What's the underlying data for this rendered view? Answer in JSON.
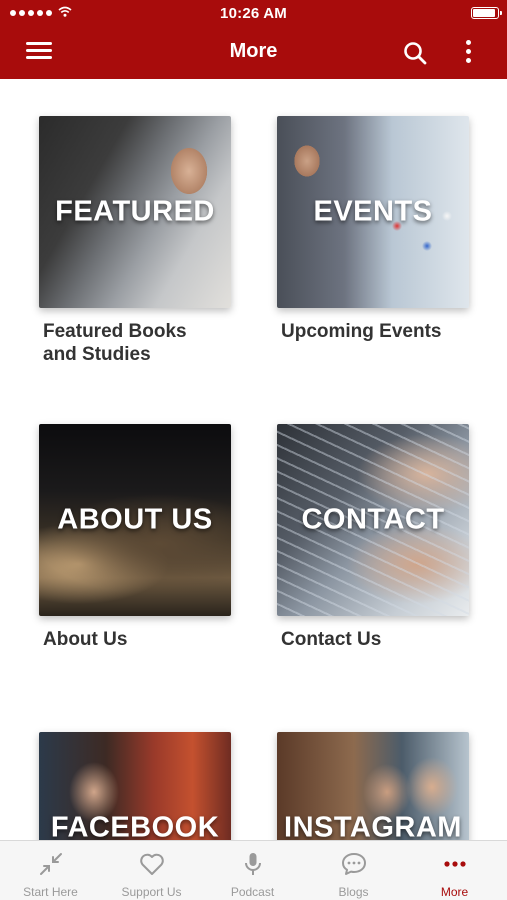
{
  "colors": {
    "brand": "#a80c0c",
    "tab_inactive": "#9a9a9a",
    "caption_text": "#333333"
  },
  "status_bar": {
    "time": "10:26 AM"
  },
  "header": {
    "title": "More",
    "menu_icon": "hamburger-menu-icon",
    "search_icon": "search-icon",
    "more_icon": "vertical-ellipsis-icon"
  },
  "tiles": [
    {
      "overlay": "FEATURED",
      "caption": "Featured Books and Studies"
    },
    {
      "overlay": "EVENTS",
      "caption": "Upcoming Events"
    },
    {
      "overlay": "ABOUT US",
      "caption": "About Us"
    },
    {
      "overlay": "CONTACT",
      "caption": "Contact Us"
    },
    {
      "overlay": "FACEBOOK",
      "caption": ""
    },
    {
      "overlay": "INSTAGRAM",
      "caption": ""
    }
  ],
  "tabbar": {
    "items": [
      {
        "label": "Start Here",
        "icon": "arrows-in-icon",
        "active": false
      },
      {
        "label": "Support Us",
        "icon": "heart-icon",
        "active": false
      },
      {
        "label": "Podcast",
        "icon": "microphone-icon",
        "active": false
      },
      {
        "label": "Blogs",
        "icon": "chat-bubble-icon",
        "active": false
      },
      {
        "label": "More",
        "icon": "horizontal-ellipsis-icon",
        "active": true
      }
    ]
  }
}
